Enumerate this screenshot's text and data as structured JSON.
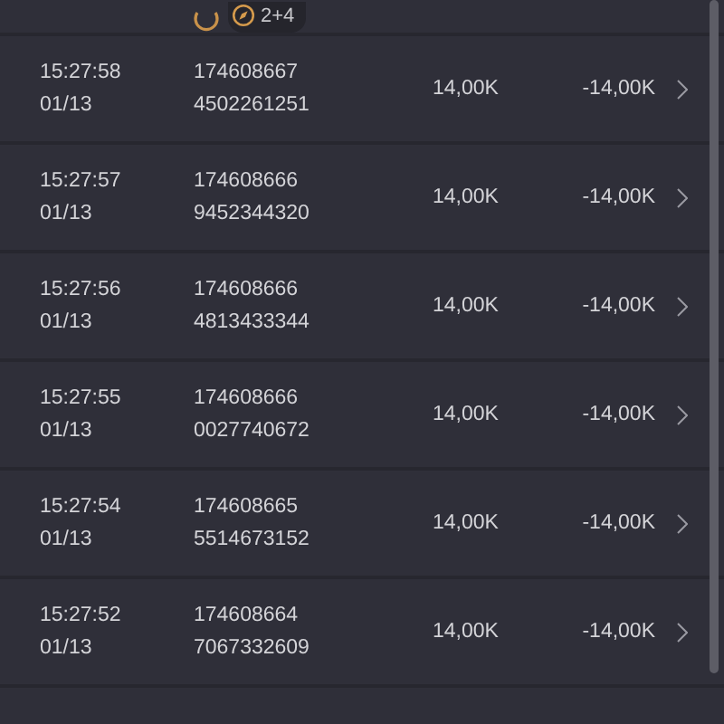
{
  "top_row": {
    "badge": "2+4"
  },
  "rows": [
    {
      "time": "15:27:58",
      "date": "01/13",
      "id_line1": "174608667",
      "id_line2": "4502261251",
      "amount": "14,00K",
      "change": "-14,00K"
    },
    {
      "time": "15:27:57",
      "date": "01/13",
      "id_line1": "174608666",
      "id_line2": "9452344320",
      "amount": "14,00K",
      "change": "-14,00K"
    },
    {
      "time": "15:27:56",
      "date": "01/13",
      "id_line1": "174608666",
      "id_line2": "4813433344",
      "amount": "14,00K",
      "change": "-14,00K"
    },
    {
      "time": "15:27:55",
      "date": "01/13",
      "id_line1": "174608666",
      "id_line2": "0027740672",
      "amount": "14,00K",
      "change": "-14,00K"
    },
    {
      "time": "15:27:54",
      "date": "01/13",
      "id_line1": "174608665",
      "id_line2": "5514673152",
      "amount": "14,00K",
      "change": "-14,00K"
    },
    {
      "time": "15:27:52",
      "date": "01/13",
      "id_line1": "174608664",
      "id_line2": "7067332609",
      "amount": "14,00K",
      "change": "-14,00K"
    }
  ]
}
